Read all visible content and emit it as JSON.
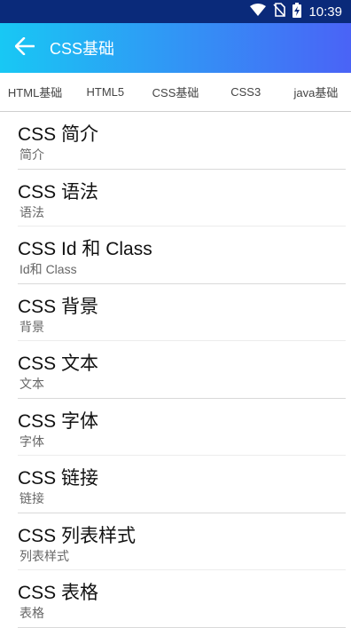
{
  "status_bar": {
    "time": "10:39",
    "icons": [
      "wifi-icon",
      "no-sim-icon",
      "battery-charging-icon"
    ]
  },
  "app_bar": {
    "title": "CSS基础",
    "back_icon": "arrow-left-icon"
  },
  "tabs": [
    {
      "label": "HTML基础"
    },
    {
      "label": "HTML5"
    },
    {
      "label": "CSS基础"
    },
    {
      "label": "CSS3"
    },
    {
      "label": "java基础"
    }
  ],
  "items": [
    {
      "title": "CSS 简介",
      "subtitle": "简介"
    },
    {
      "title": "CSS 语法",
      "subtitle": "语法"
    },
    {
      "title": "CSS Id 和 Class",
      "subtitle": "Id和 Class"
    },
    {
      "title": "CSS 背景",
      "subtitle": "背景"
    },
    {
      "title": "CSS 文本",
      "subtitle": "文本"
    },
    {
      "title": "CSS 字体",
      "subtitle": "字体"
    },
    {
      "title": "CSS 链接",
      "subtitle": "链接"
    },
    {
      "title": "CSS 列表样式",
      "subtitle": "列表样式"
    },
    {
      "title": "CSS 表格",
      "subtitle": "表格"
    }
  ],
  "colors": {
    "status_bar": "#0a2a7a",
    "appbar_start": "#18c8f4",
    "appbar_end": "#4a63f6"
  }
}
